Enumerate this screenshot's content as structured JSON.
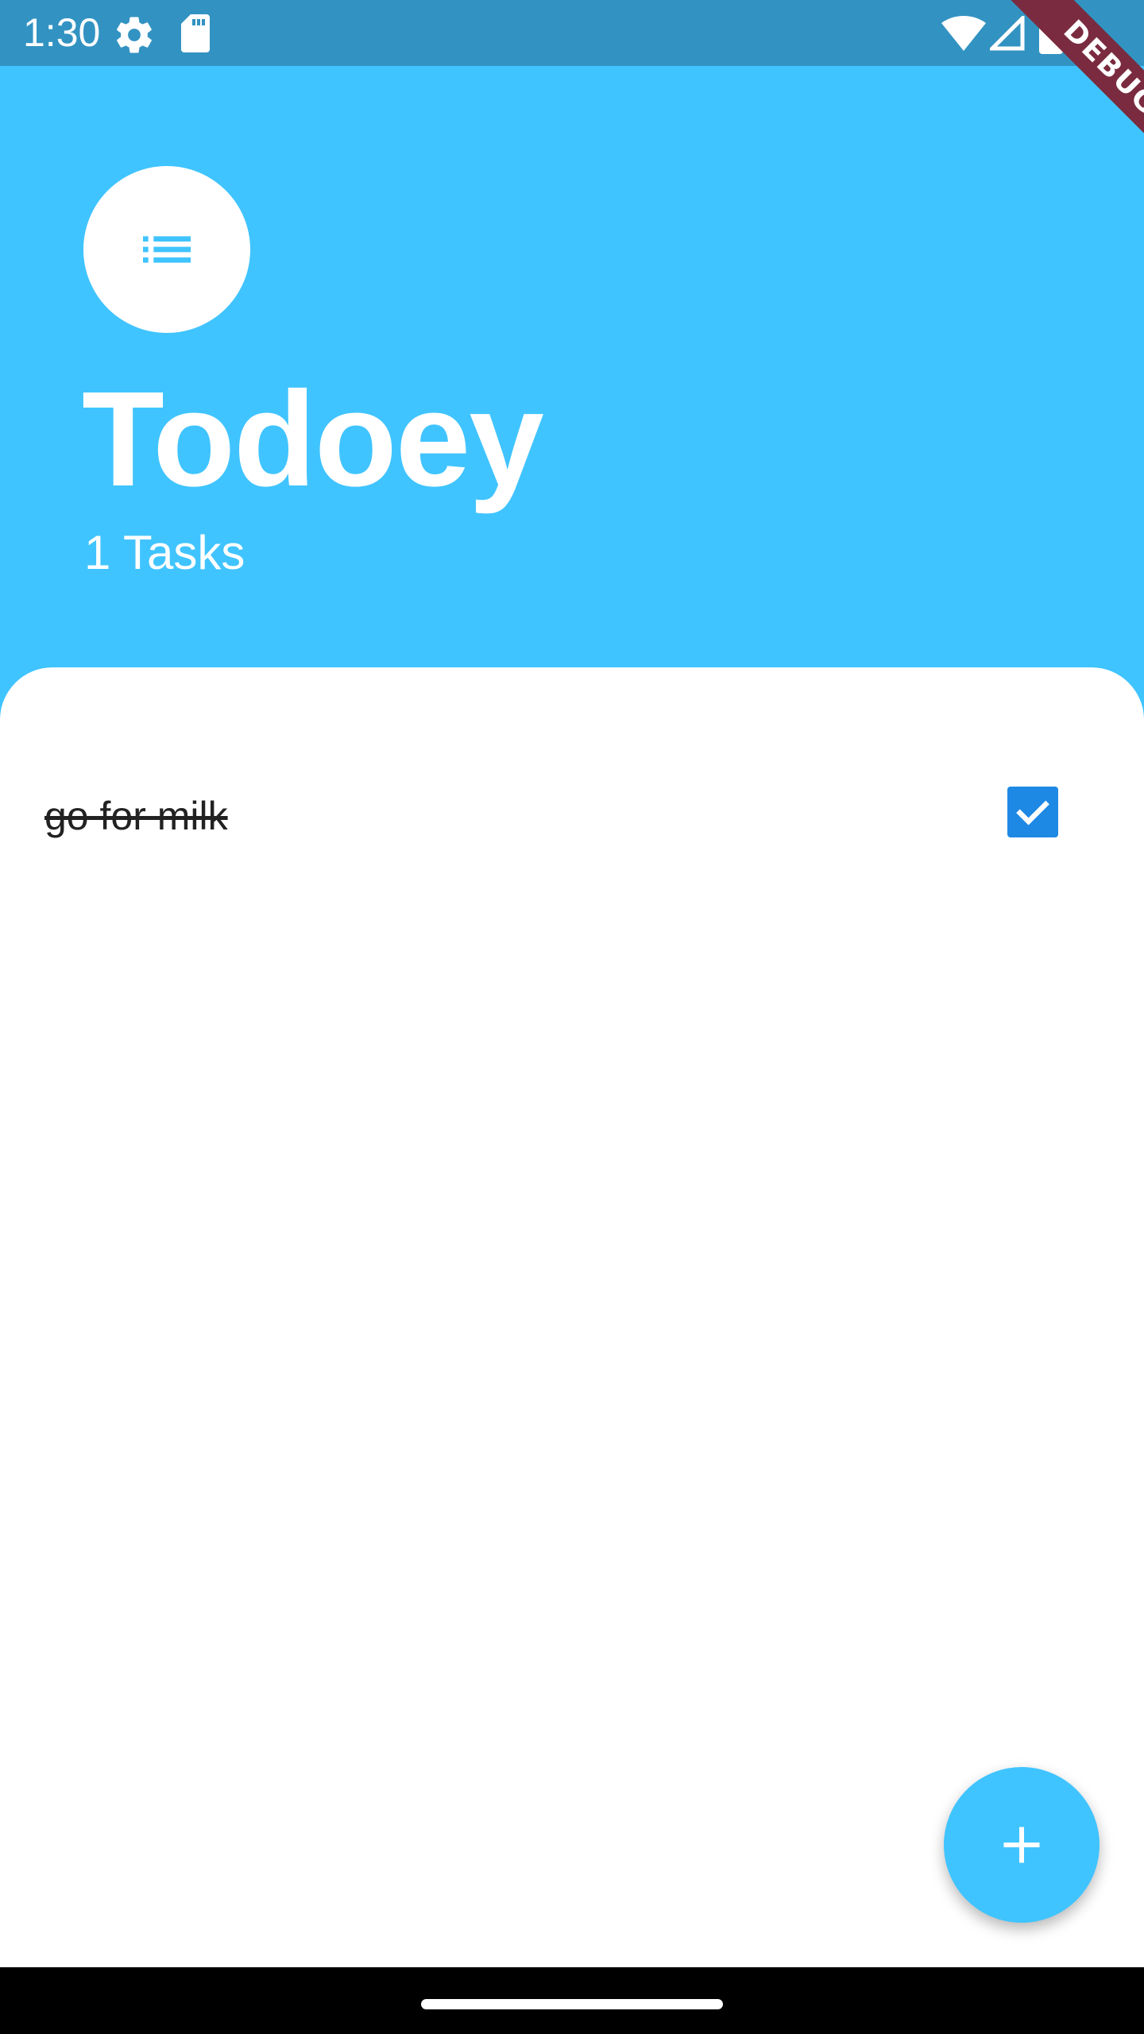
{
  "status_bar": {
    "time": "1:30",
    "icons": [
      "settings-gear-icon",
      "sd-card-icon",
      "wifi-icon",
      "cell-signal-icon",
      "battery-icon"
    ]
  },
  "debug_banner": {
    "label": "DEBUG"
  },
  "header": {
    "icon": "list-icon",
    "title": "Todoey",
    "task_count": "1 Tasks"
  },
  "tasks": [
    {
      "title": "go for milk",
      "done": true
    }
  ],
  "fab": {
    "icon": "plus-icon"
  },
  "colors": {
    "accent": "#40c4ff",
    "status_bar": "#3293c2",
    "checkbox": "#1e88e5",
    "debug_ribbon": "#7a2b3f",
    "nav_bar": "#000000"
  }
}
